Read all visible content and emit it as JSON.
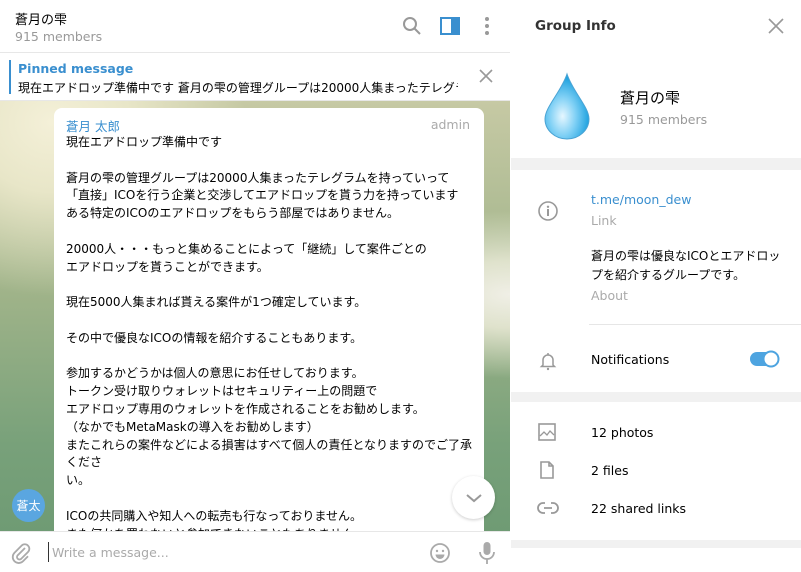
{
  "chat": {
    "title": "蒼月の雫",
    "members": "915 members",
    "pinned": {
      "title": "Pinned message",
      "text": "現在エアドロップ準備中です  蒼月の雫の管理グループは20000人集まったテレグラ..."
    },
    "message": {
      "sender": "蒼月 太郎",
      "role": "admin",
      "avatar_initials": "蒼太",
      "lines": [
        "現在エアドロップ準備中です",
        "",
        "蒼月の雫の管理グループは20000人集まったテレグラムを持っていって",
        "「直接」ICOを行う企業と交渉してエアドロップを貰う力を持っています",
        "ある特定のICOのエアドロップをもらう部屋ではありません。",
        "",
        "20000人・・・もっと集めることによって「継続」して案件ごとの",
        "エアドロップを貰うことができます。",
        "",
        "現在5000人集まれば貰える案件が1つ確定しています。",
        "",
        "その中で優良なICOの情報を紹介することもあります。",
        "",
        "参加するかどうかは個人の意思にお任せしております。",
        "トークン受け取りウォレットはセキュリティー上の問題で",
        "エアドロップ専用のウォレットを作成されることをお勧めします。",
        "（なかでもMetaMaskの導入をお勧めします）",
        "またこれらの案件などによる損害はすべて個人の責任となりますのでご了承くださ",
        "い。",
        "",
        "ICOの共同購入や知人への転売も行なっておりません。",
        "また何かを買わないと参加できないこともありません。"
      ]
    },
    "composer": {
      "placeholder": "Write a message..."
    }
  },
  "panel": {
    "title": "Group Info",
    "name": "蒼月の雫",
    "members": "915 members",
    "link": "t.me/moon_dew",
    "link_label": "Link",
    "about_lines": [
      "蒼月の雫は優良なICOとエアドロッ",
      "プを紹介するグループです。"
    ],
    "about_label": "About",
    "notifications": "Notifications",
    "notifications_on": true,
    "media": {
      "photos": "12 photos",
      "files": "2 files",
      "links": "22 shared links"
    }
  },
  "colors": {
    "accent": "#3a8fcf",
    "toggle": "#4ea4e0"
  }
}
